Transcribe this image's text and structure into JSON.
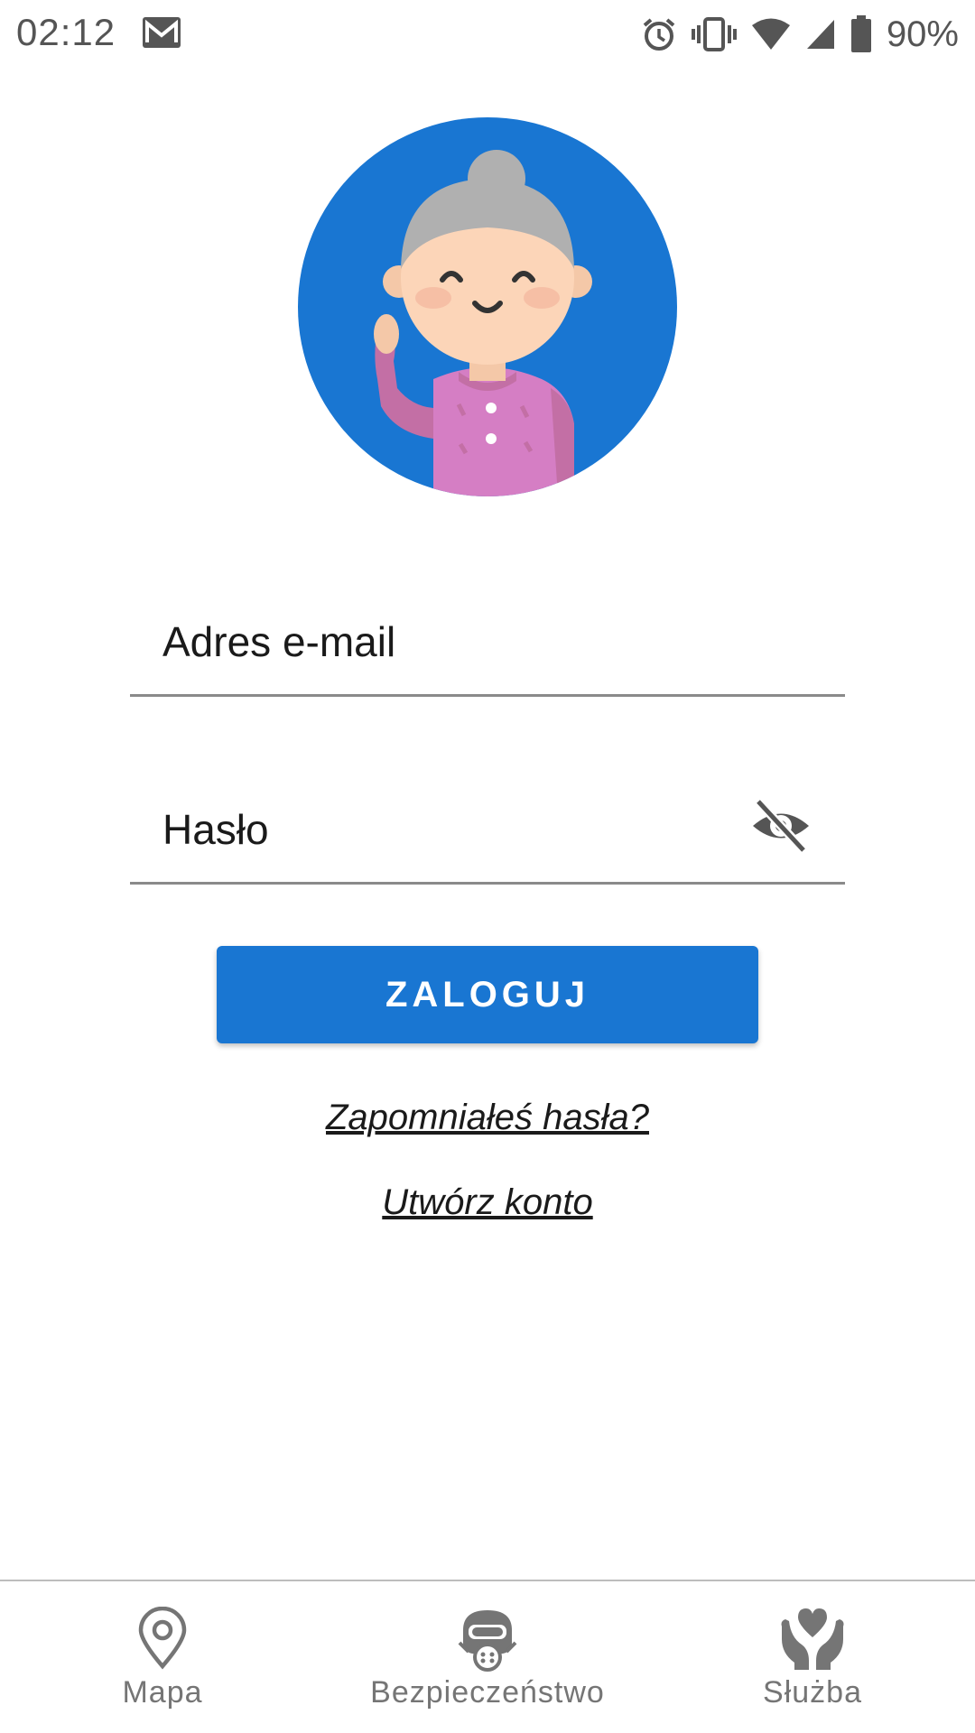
{
  "status_bar": {
    "time": "02:12",
    "battery": "90%",
    "icons": [
      "gmail-icon",
      "alarm-icon",
      "vibrate-icon",
      "wifi-icon",
      "signal-icon",
      "battery-icon"
    ]
  },
  "avatar": {
    "icon": "grandma-avatar-icon",
    "background_color": "#1976d2"
  },
  "login_form": {
    "email_placeholder": "Adres e-mail",
    "email_value": "",
    "password_placeholder": "Hasło",
    "password_value": "",
    "password_toggle_icon": "eye-off-icon",
    "login_button": "ZALOGUJ",
    "forgot_password": "Zapomniałeś hasła?",
    "create_account": "Utwórz konto"
  },
  "bottom_nav": {
    "items": [
      {
        "label": "Mapa",
        "icon": "map-pin-icon"
      },
      {
        "label": "Bezpieczeństwo",
        "icon": "gas-mask-icon"
      },
      {
        "label": "Służba",
        "icon": "hands-heart-icon"
      }
    ]
  },
  "colors": {
    "accent": "#1976d2",
    "nav_text": "#757575",
    "divider": "#8a8a8a"
  }
}
